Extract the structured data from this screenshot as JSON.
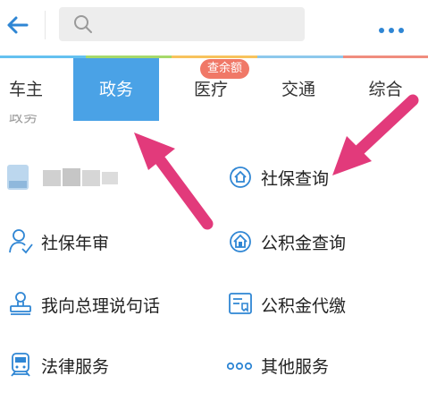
{
  "header": {
    "search_placeholder": "",
    "more_icon": "more-dots-icon",
    "back_icon": "back-arrow-icon"
  },
  "tabs": [
    {
      "label": "车主"
    },
    {
      "label": "政务"
    },
    {
      "label": "医疗"
    },
    {
      "label": "交通"
    },
    {
      "label": "综合"
    }
  ],
  "badge": {
    "text": "查余额"
  },
  "section_label": "政务",
  "services": [
    {
      "label": "",
      "icon": "blurred-avatar"
    },
    {
      "label": "社保查询",
      "icon": "shield-house-icon"
    },
    {
      "label": "社保年审",
      "icon": "person-check-icon"
    },
    {
      "label": "公积金查询",
      "icon": "house-coin-icon"
    },
    {
      "label": "我向总理说句话",
      "icon": "stamp-person-icon"
    },
    {
      "label": "公积金代缴",
      "icon": "card-receipt-icon"
    },
    {
      "label": "法律服务",
      "icon": "train-icon"
    },
    {
      "label": "其他服务",
      "icon": "three-circles-icon"
    }
  ],
  "colors": {
    "accent_blue": "#4aa2e6",
    "icon_blue": "#2f86d4",
    "badge_red": "#f07867",
    "arrow_pink": "#e23a7b"
  }
}
